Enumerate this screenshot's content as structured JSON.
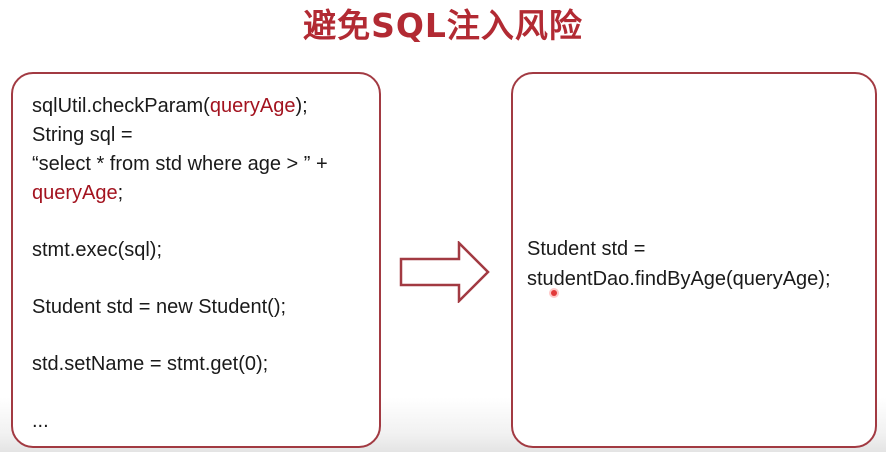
{
  "title": "避免SQL注入风险",
  "left_panel": {
    "line1_a": "sqlUtil.checkParam(",
    "line1_param": "queryAge",
    "line1_b": ");",
    "line2": "String sql =",
    "line3": "“select * from std where age > ” +",
    "line4_param": "queryAge",
    "line4_b": ";",
    "line5": "stmt.exec(sql);",
    "line6": "Student std = new Student();",
    "line7": "std.setName = stmt.get(0);",
    "line8": "..."
  },
  "right_panel": {
    "line1": "Student std =",
    "line2": "studentDao.findByAge(queryAge);"
  },
  "colors": {
    "title": "#b22a33",
    "border": "#a23a42",
    "highlight": "#a3131f",
    "text": "#1a1a1a"
  }
}
